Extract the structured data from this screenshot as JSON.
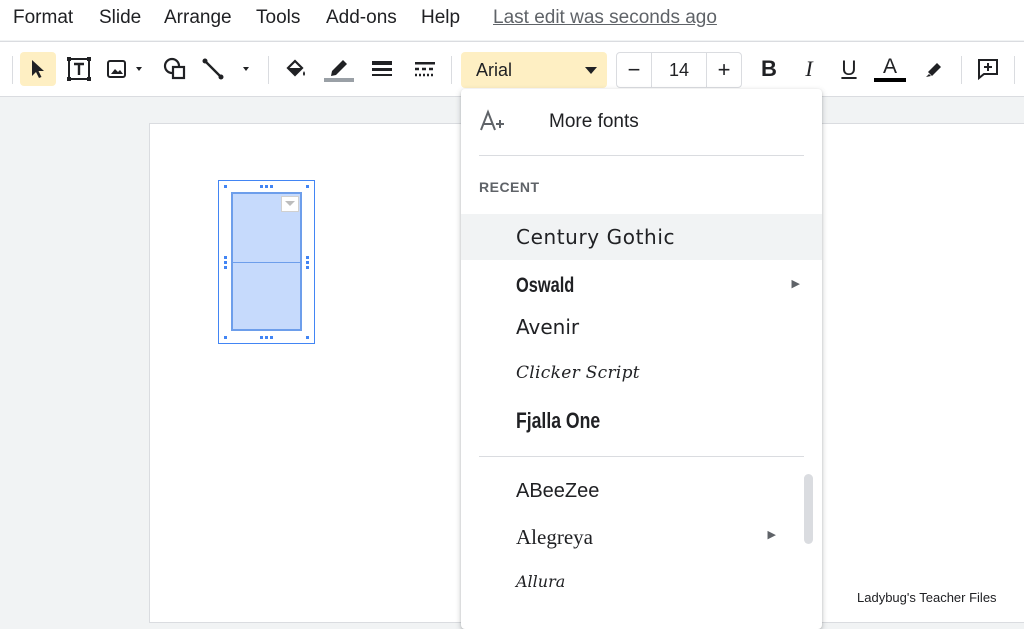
{
  "menubar": {
    "items": [
      "Format",
      "Slide",
      "Arrange",
      "Tools",
      "Add-ons",
      "Help"
    ],
    "last_edit": "Last edit was seconds ago"
  },
  "toolbar": {
    "font_name": "Arial",
    "font_size": "14",
    "minus": "−",
    "plus": "+",
    "bold": "B",
    "italic": "I",
    "underline": "U",
    "text_color": "A",
    "text_color_value": "#000000",
    "accent": "#feefc3"
  },
  "font_menu": {
    "more_fonts": "More fonts",
    "recent_heading": "RECENT",
    "recent": [
      {
        "label": "Century Gothic",
        "highlighted": true
      },
      {
        "label": "Oswald",
        "has_submenu": true
      },
      {
        "label": "Avenir"
      },
      {
        "label": "Clicker Script"
      },
      {
        "label": "Fjalla One"
      }
    ],
    "all": [
      {
        "label": "ABeeZee"
      },
      {
        "label": "Alegreya",
        "has_submenu": true
      },
      {
        "label": "Allura"
      }
    ],
    "submenu_arrow": "▶"
  },
  "watermark": "Ladybug's Teacher Files"
}
